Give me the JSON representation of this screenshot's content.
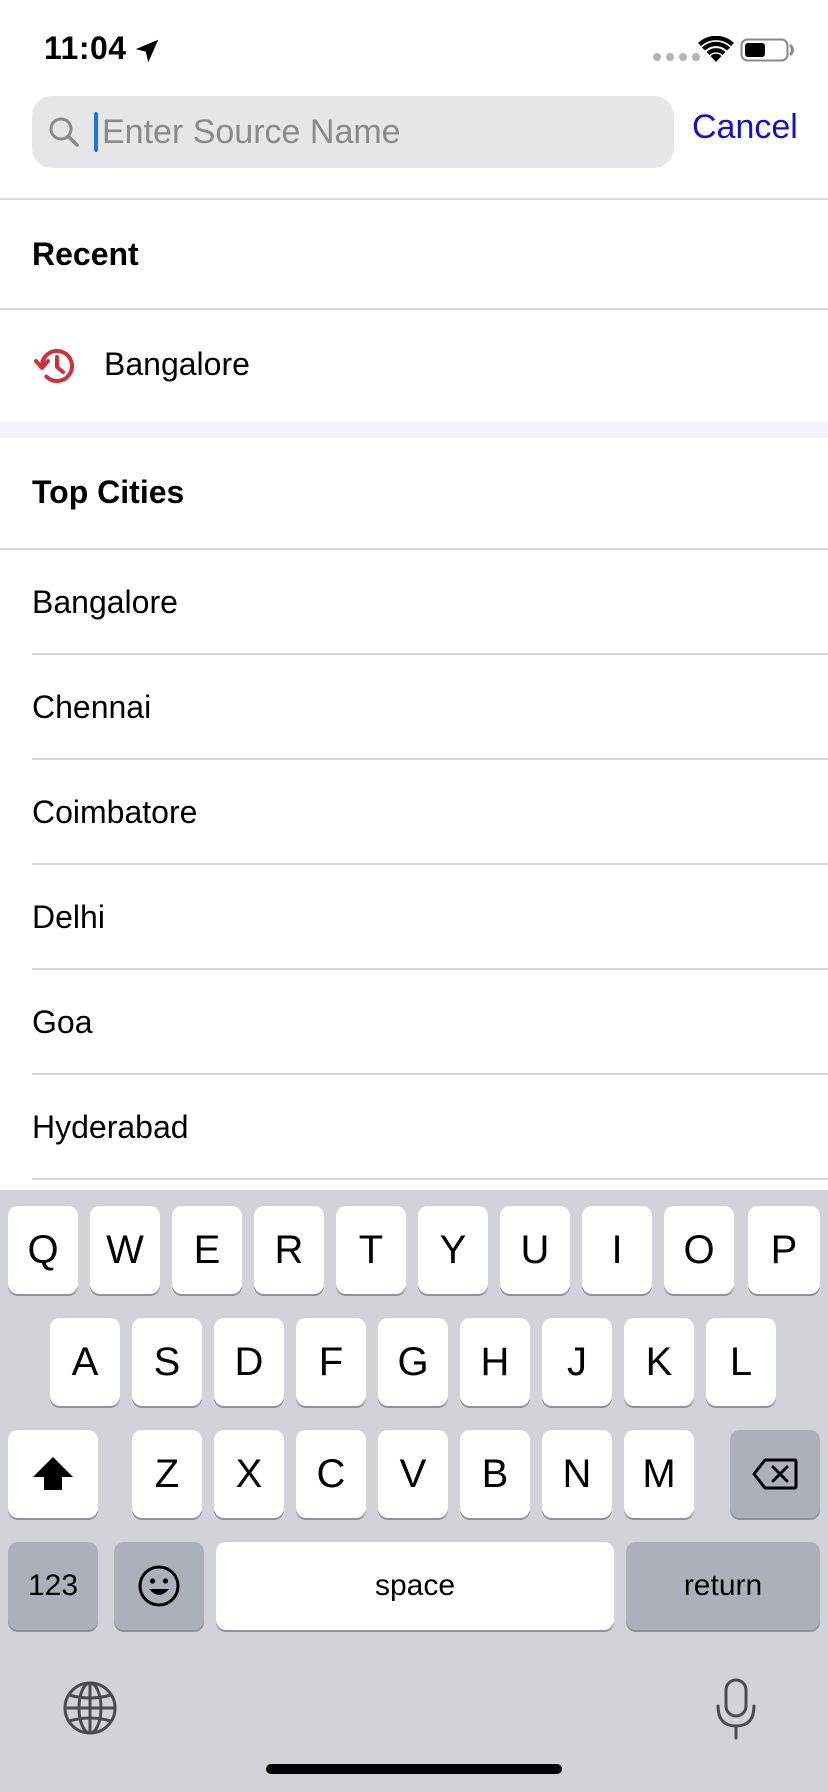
{
  "status_bar": {
    "time": "11:04"
  },
  "search": {
    "placeholder": "Enter Source Name",
    "value": "",
    "cancel_label": "Cancel"
  },
  "recent": {
    "header": "Recent",
    "items": [
      {
        "label": "Bangalore",
        "icon": "history-icon"
      }
    ]
  },
  "top_cities": {
    "header": "Top Cities",
    "items": [
      {
        "label": "Bangalore"
      },
      {
        "label": "Chennai"
      },
      {
        "label": "Coimbatore"
      },
      {
        "label": "Delhi"
      },
      {
        "label": "Goa"
      },
      {
        "label": "Hyderabad"
      }
    ]
  },
  "keyboard": {
    "row1": [
      "Q",
      "W",
      "E",
      "R",
      "T",
      "Y",
      "U",
      "I",
      "O",
      "P"
    ],
    "row2": [
      "A",
      "S",
      "D",
      "F",
      "G",
      "H",
      "J",
      "K",
      "L"
    ],
    "row3": [
      "Z",
      "X",
      "C",
      "V",
      "B",
      "N",
      "M"
    ],
    "numbers_label": "123",
    "space_label": "space",
    "return_label": "return"
  },
  "colors": {
    "accent": "#1410c8",
    "history_icon": "#d0303a",
    "caret": "#1a73e8",
    "keyboard_bg": "#d1d3d9"
  }
}
